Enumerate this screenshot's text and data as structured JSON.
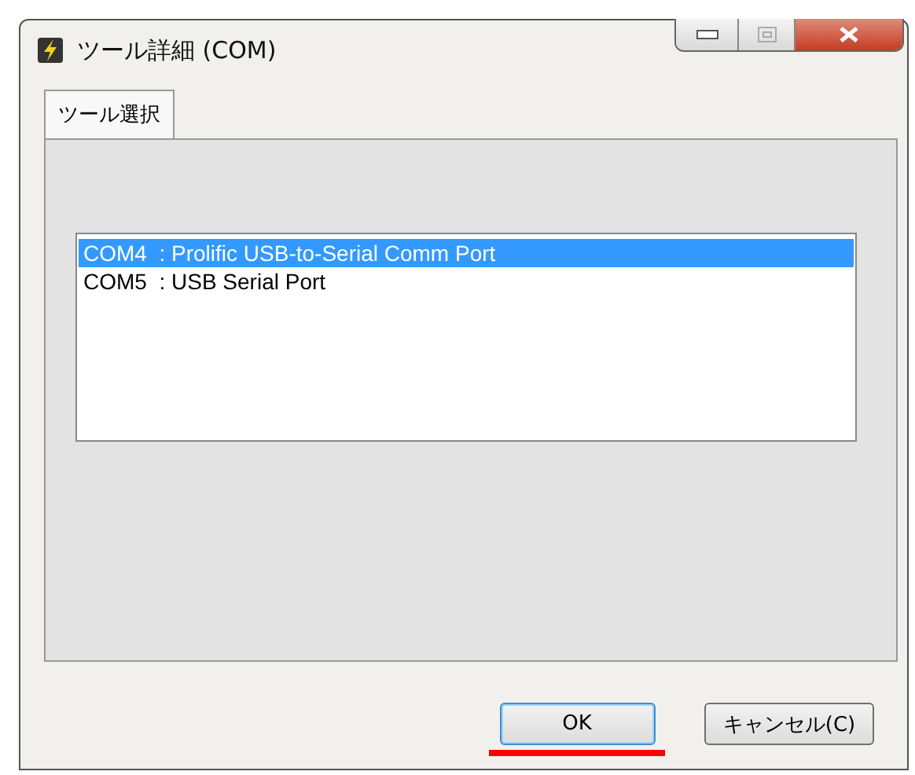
{
  "window": {
    "title": "ツール詳細 (COM)"
  },
  "tabs": [
    {
      "label": "ツール選択",
      "selected": true
    }
  ],
  "list": [
    {
      "text": "COM4  : Prolific USB-to-Serial Comm Port",
      "selected": true
    },
    {
      "text": "COM5  : USB Serial Port",
      "selected": false
    }
  ],
  "buttons": [
    {
      "label": "OK",
      "default": true,
      "highlighted": true
    },
    {
      "label": "キャンセル(C)",
      "default": false,
      "highlighted": false
    }
  ]
}
